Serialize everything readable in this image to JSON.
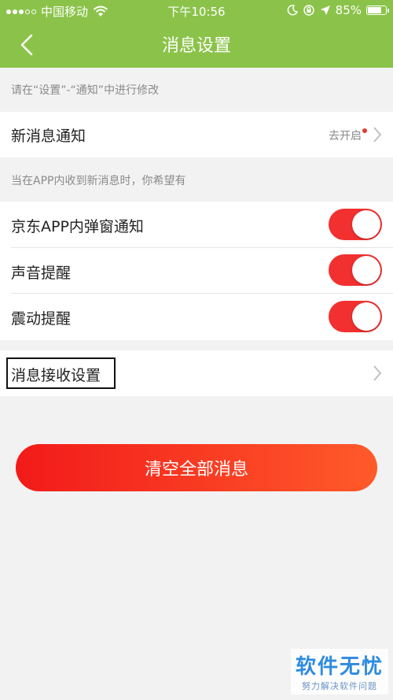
{
  "status_bar": {
    "carrier": "中国移动",
    "time": "下午10:56",
    "battery": "85%",
    "battery_level": 0.85
  },
  "nav": {
    "title": "消息设置"
  },
  "hints": {
    "system": "请在“设置”-“通知”中进行修改",
    "in_app": "当在APP内收到新消息时，你希望有"
  },
  "rows": {
    "new_message": {
      "label": "新消息通知",
      "value": "去开启"
    },
    "popup": {
      "label": "京东APP内弹窗通知",
      "on": true
    },
    "sound": {
      "label": "声音提醒",
      "on": true
    },
    "vibrate": {
      "label": "震动提醒",
      "on": true
    },
    "receive": {
      "label": "消息接收设置"
    }
  },
  "clear_button": {
    "label": "清空全部消息"
  },
  "watermark": {
    "title": "软件无忧",
    "subtitle": "努力解决软件问题"
  },
  "colors": {
    "header": "#8bc34a",
    "toggle_on": "#f23030",
    "button_start": "#f21a1a",
    "button_end": "#ff5a2a"
  }
}
